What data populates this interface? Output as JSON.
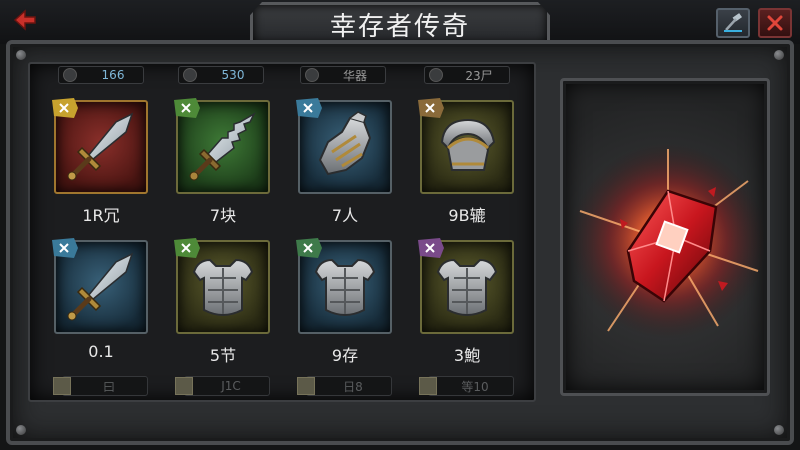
{
  "header": {
    "title": "幸存者传奇"
  },
  "icons": {
    "back": "back-arrow-icon",
    "hammer": "hammer-icon",
    "close": "close-x-icon",
    "reward": "red-crystal-gem-icon"
  },
  "colors": {
    "stat_value": "#7fb7d8",
    "close": "#e0463a",
    "gem": "#d8232a"
  },
  "stats": [
    "166",
    "530",
    "华器",
    "23尸"
  ],
  "items": [
    {
      "label": "1R冗",
      "art": "sword-icon",
      "bg": "red"
    },
    {
      "label": "7块",
      "art": "serrated-sword-icon",
      "bg": "green"
    },
    {
      "label": "7人",
      "art": "gauntlet-icon",
      "bg": "blue"
    },
    {
      "label": "9B辘",
      "art": "pauldron-icon",
      "bg": "olive"
    },
    {
      "label": "0.1",
      "art": "sword-icon",
      "bg": "blue"
    },
    {
      "label": "5节",
      "art": "chest-armor-icon",
      "bg": "olive"
    },
    {
      "label": "9存",
      "art": "chest-armor-icon",
      "bg": "blue"
    },
    {
      "label": "3鮑",
      "art": "chest-armor-icon",
      "bg": "olive"
    }
  ],
  "bottom": [
    "曰",
    "J1C",
    "日8",
    "等10"
  ]
}
